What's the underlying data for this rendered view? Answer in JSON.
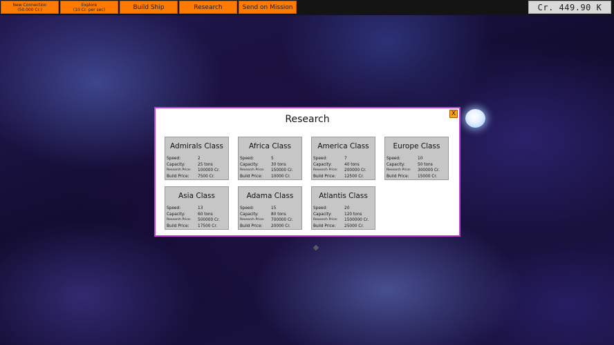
{
  "topbar": {
    "buttons": [
      {
        "line1": "New Connection",
        "line2": "(50.000 Cr.)"
      },
      {
        "line1": "Explore",
        "line2": "(10 Cr. per sec)"
      },
      {
        "label": "Build Ship"
      },
      {
        "label": "Research"
      },
      {
        "label": "Send on Mission"
      }
    ],
    "credits": "Cr. 449.90 K"
  },
  "dialog": {
    "title": "Research",
    "close_label": "X",
    "stat_labels": {
      "speed": "Speed:",
      "capacity": "Capacity:",
      "research_price": "Research Price:",
      "build_price": "Build Price:"
    },
    "ships": [
      {
        "name": "Admirals Class",
        "speed": "2",
        "capacity": "25 tons",
        "research_price": "100000 Cr.",
        "build_price": "7500 Cr."
      },
      {
        "name": "Africa Class",
        "speed": "5",
        "capacity": "30 tons",
        "research_price": "150000 Cr.",
        "build_price": "10000 Cr."
      },
      {
        "name": "America Class",
        "speed": "7",
        "capacity": "40 tons",
        "research_price": "200000 Cr.",
        "build_price": "12500 Cr."
      },
      {
        "name": "Europe Class",
        "speed": "10",
        "capacity": "50 tons",
        "research_price": "300000 Cr.",
        "build_price": "15000 Cr."
      },
      {
        "name": "Asia Class",
        "speed": "13",
        "capacity": "60 tons",
        "research_price": "500000 Cr.",
        "build_price": "17500 Cr."
      },
      {
        "name": "Adama Class",
        "speed": "15",
        "capacity": "80 tons",
        "research_price": "700000 Cr.",
        "build_price": "20000 Cr."
      },
      {
        "name": "Atlantis Class",
        "speed": "20",
        "capacity": "120 tons",
        "research_price": "1500000 Cr.",
        "build_price": "25000 Cr."
      }
    ]
  },
  "colors": {
    "button": "#ff7a00",
    "dialog_border": "#c63ed0",
    "card": "#c6c6c6",
    "close_button": "#ffa010"
  }
}
